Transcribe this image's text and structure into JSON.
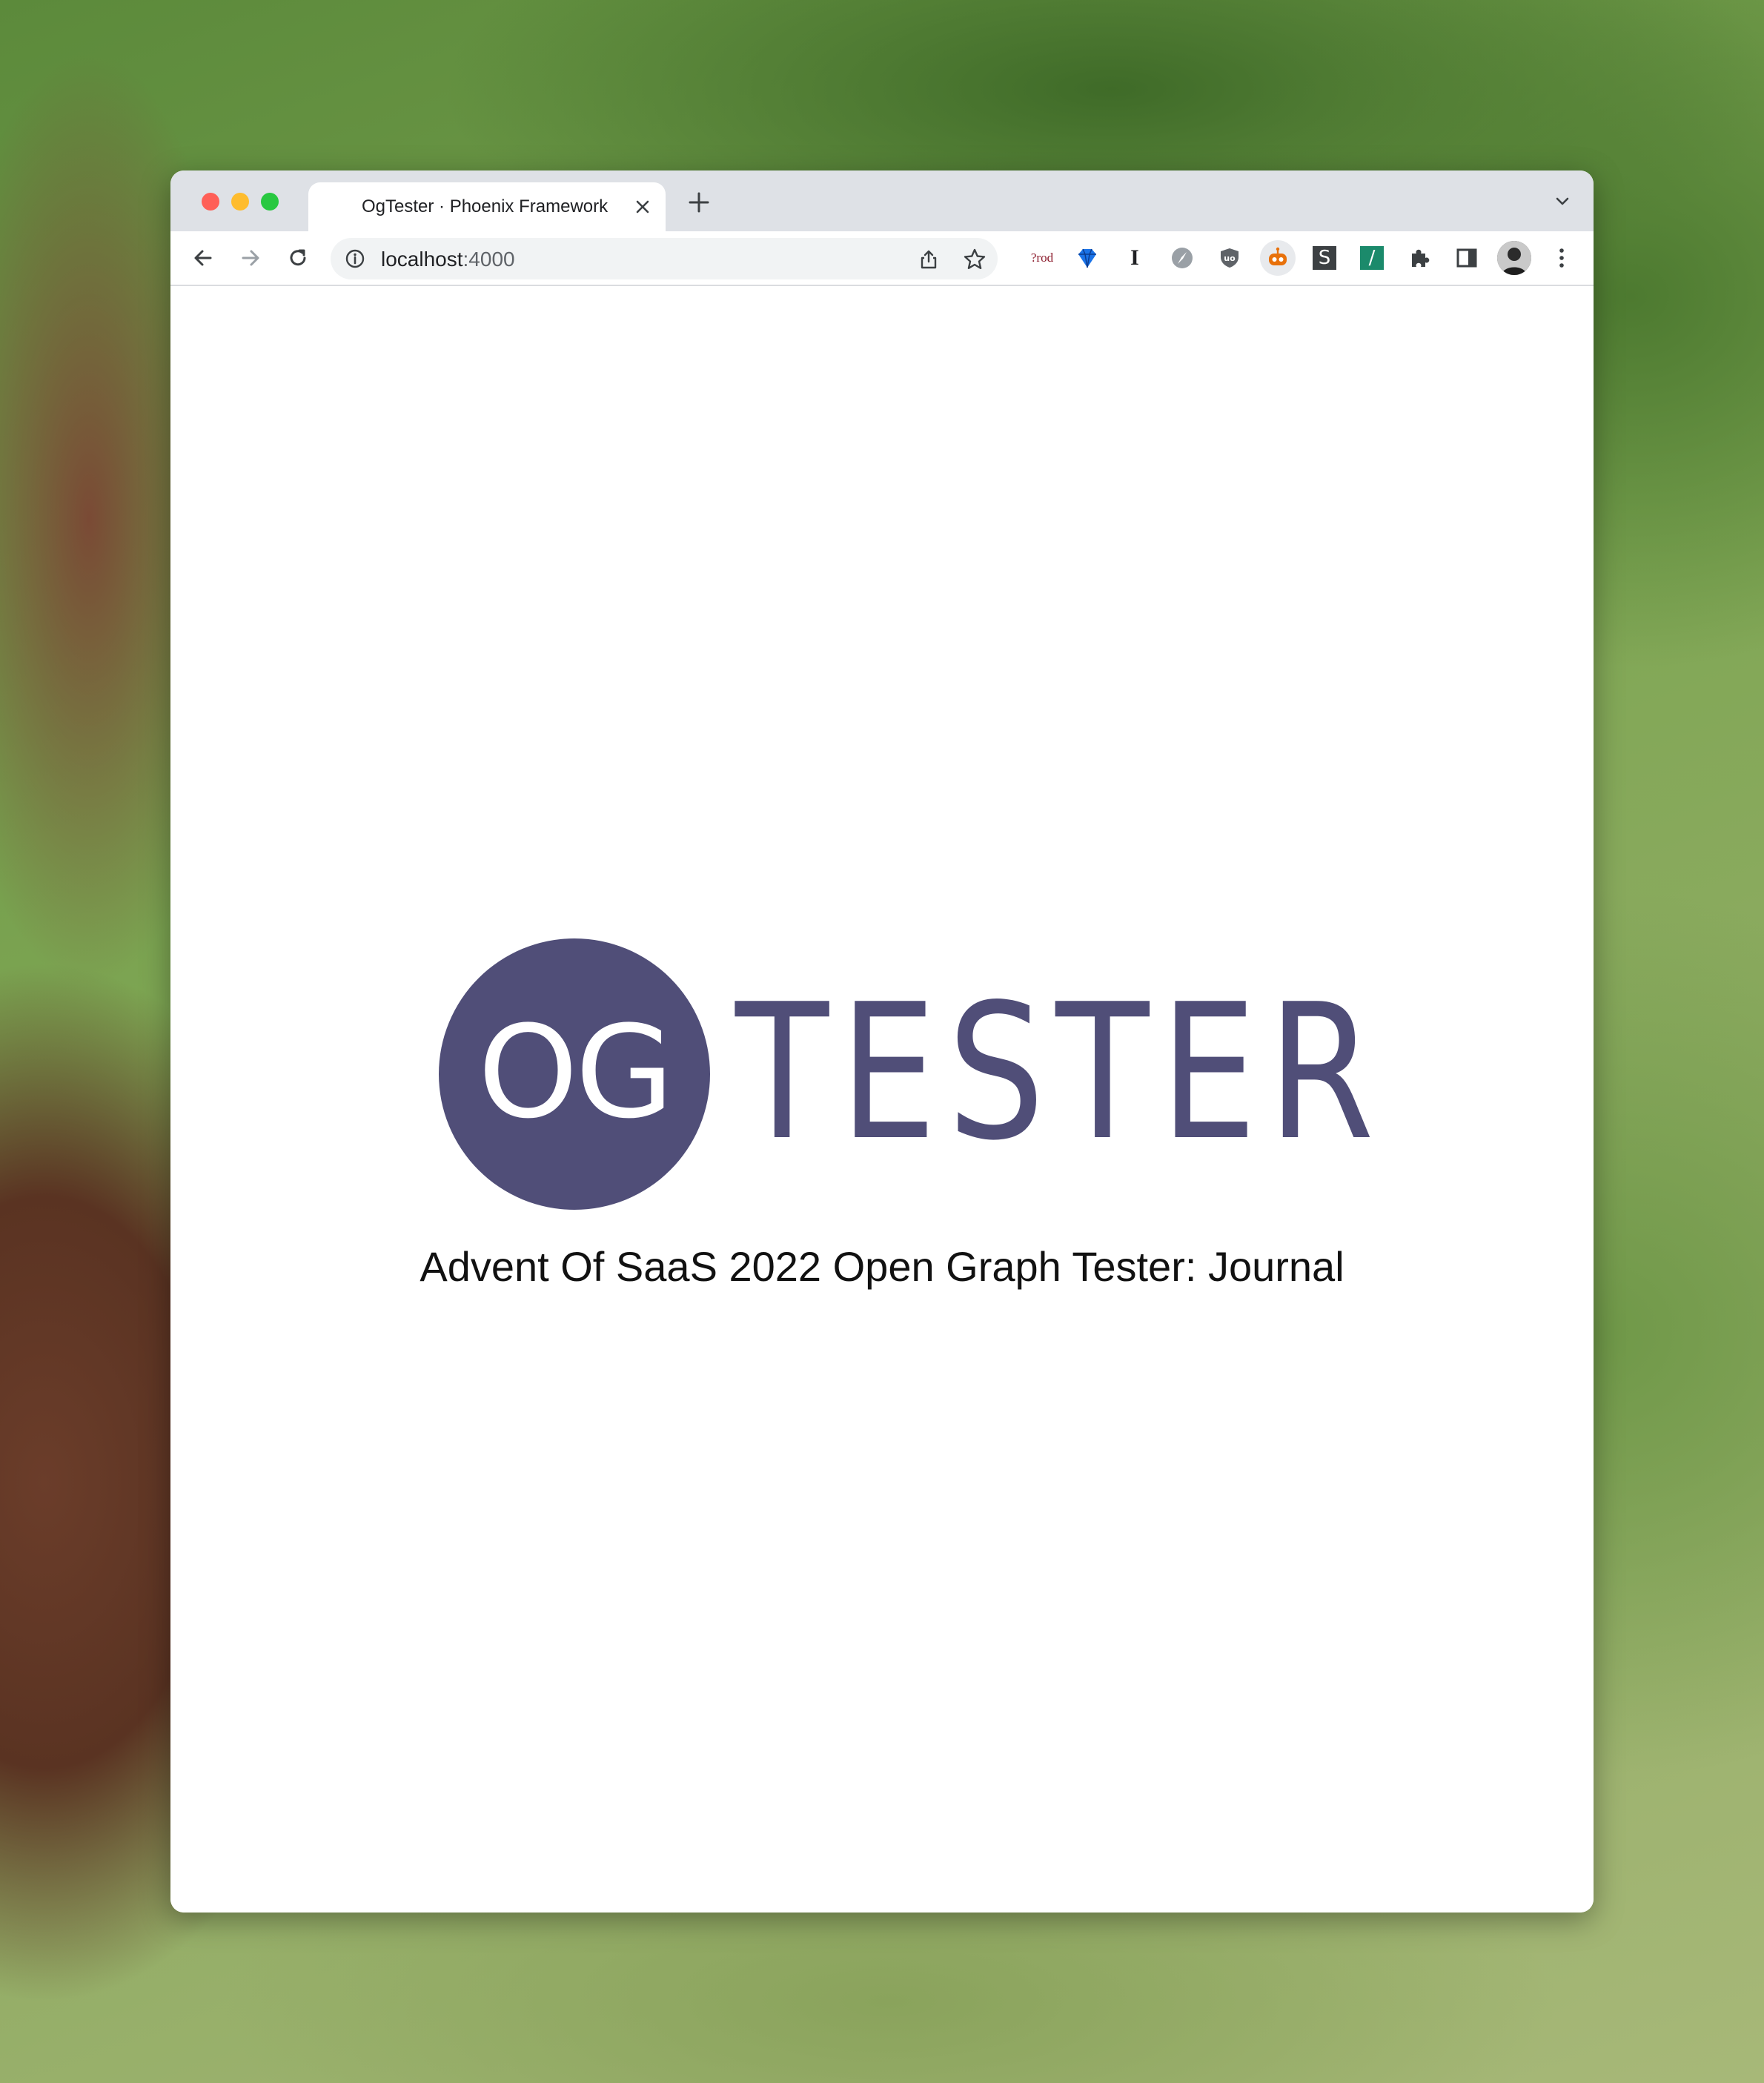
{
  "tab": {
    "title": "OgTester · Phoenix Framework"
  },
  "address_bar": {
    "host": "localhost",
    "port": ":4000"
  },
  "extensions": [
    {
      "name": "prod-extension",
      "label": "?rod"
    },
    {
      "name": "gem-extension"
    },
    {
      "name": "i-extension",
      "label": "I"
    },
    {
      "name": "compass-extension"
    },
    {
      "name": "ublock-extension",
      "label": "uo"
    },
    {
      "name": "robot-extension"
    },
    {
      "name": "s-extension",
      "label": "S"
    },
    {
      "name": "slash-extension",
      "label": "/"
    }
  ],
  "page": {
    "logo_circle_text": "OG",
    "logo_word": "TESTER",
    "tagline": "Advent Of SaaS 2022 Open Graph Tester: Journal"
  },
  "colors": {
    "brand": "#504e78",
    "tabbar": "#dee1e6",
    "omnibox": "#f1f3f4"
  }
}
